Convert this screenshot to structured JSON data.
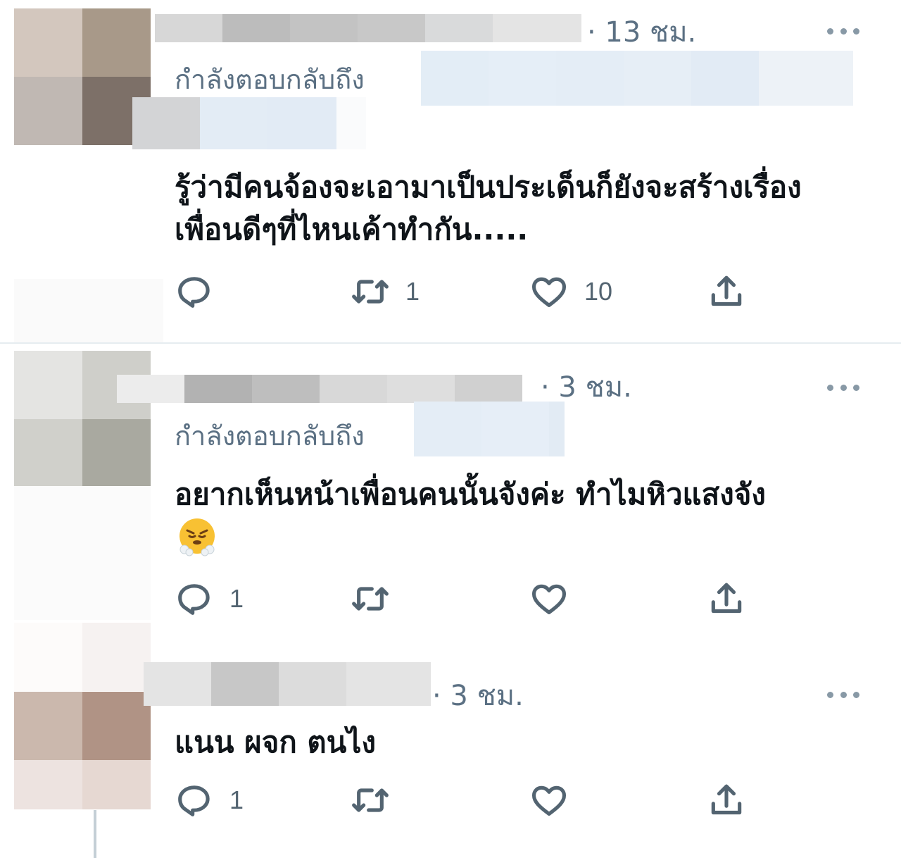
{
  "tweets": [
    {
      "time": "· 13 ชม.",
      "reply_prefix": "กำลังตอบกลับถึง",
      "text_lines": [
        "รู้ว่ามีคนจ้องจะเอามาเป็นประเด็นก็ยังจะสร้างเรื่อง",
        "เพื่อนดีๆที่ไหนเค้าทำกัน....."
      ],
      "replies": "",
      "retweets": "1",
      "likes": "10"
    },
    {
      "time": "· 3 ชม.",
      "reply_prefix": "กำลังตอบกลับถึง",
      "text_lines": [
        "อยากเห็นหน้าเพื่อนคนนั้นจังค่ะ ทำไมหิวแสงจัง"
      ],
      "emoji": "face-with-steam-from-nose",
      "replies": "1",
      "retweets": "",
      "likes": ""
    },
    {
      "time": "· 3 ชม.",
      "text_lines": [
        "แนน ผจก ตนไง"
      ],
      "replies": "1",
      "retweets": "",
      "likes": ""
    }
  ],
  "icons": {
    "reply": "reply-icon",
    "retweet": "retweet-icon",
    "like": "heart-icon",
    "share": "share-icon",
    "more": "more-icon"
  },
  "colors": {
    "secondary_text": "#5b7083",
    "icon": "#536471",
    "divider": "#e6ecf0",
    "censor_blue": "#e3edf6"
  }
}
